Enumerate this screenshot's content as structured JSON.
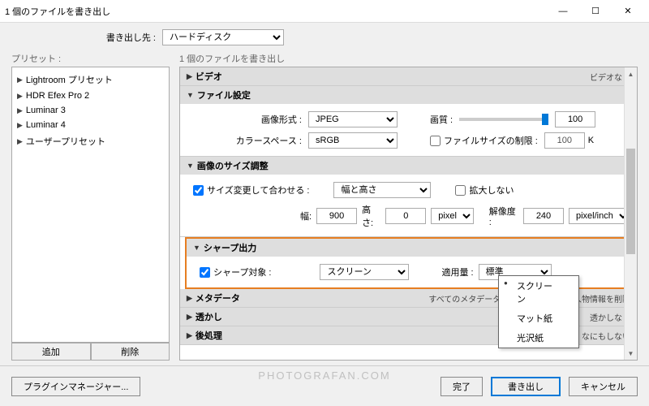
{
  "window": {
    "title": "1 個のファイルを書き出し"
  },
  "destination": {
    "label": "書き出し先 :",
    "selected": "ハードディスク"
  },
  "presets": {
    "header": "プリセット :",
    "items": [
      {
        "label": "Lightroom プリセット"
      },
      {
        "label": "HDR Efex Pro 2"
      },
      {
        "label": "Luminar 3"
      },
      {
        "label": "Luminar 4"
      },
      {
        "label": "ユーザープリセット"
      }
    ],
    "add": "追加",
    "remove": "削除"
  },
  "panels": {
    "header": "1 個のファイルを書き出し",
    "video": {
      "title": "ビデオ",
      "summary": "ビデオなし"
    },
    "fileSettings": {
      "title": "ファイル設定",
      "formatLabel": "画像形式 :",
      "format": "JPEG",
      "qualityLabel": "画質 :",
      "quality": "100",
      "colorSpaceLabel": "カラースペース :",
      "colorSpace": "sRGB",
      "limitLabel": "ファイルサイズの制限 :",
      "limitValue": "100",
      "limitUnit": "K"
    },
    "sizing": {
      "title": "画像のサイズ調整",
      "resizeChk": "サイズ変更して合わせる :",
      "mode": "幅と高さ",
      "noEnlarge": "拡大しない",
      "widthLabel": "幅:",
      "width": "900",
      "heightLabel": "高さ:",
      "height": "0",
      "unit": "pixel",
      "resLabel": "解像度 :",
      "res": "240",
      "resUnit": "pixel/inch"
    },
    "sharpen": {
      "title": "シャープ出力",
      "chkLabel": "シャープ対象 :",
      "target": "スクリーン",
      "amountLabel": "適用量 :",
      "amount": "標準",
      "options": [
        "スクリーン",
        "マット紙",
        "光沢紙"
      ]
    },
    "metadata": {
      "title": "メタデータ",
      "summary": "すべてのメタデータ、場所情報を削除、人物情報を削除"
    },
    "watermark": {
      "title": "透かし",
      "summary": "透かしなし"
    },
    "post": {
      "title": "後処理",
      "summary": "なにもしない"
    }
  },
  "footer": {
    "pluginMgr": "プラグインマネージャー...",
    "done": "完了",
    "export": "書き出し",
    "cancel": "キャンセル"
  },
  "watermarkText": "Photografan.com"
}
